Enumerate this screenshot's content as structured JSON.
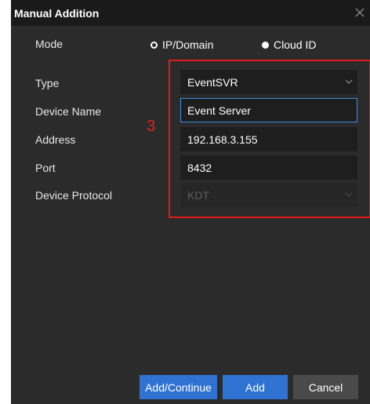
{
  "dialog": {
    "title": "Manual Addition"
  },
  "form": {
    "mode_label": "Mode",
    "mode_options": [
      "IP/Domain",
      "Cloud ID"
    ],
    "mode_selected": "IP/Domain",
    "type_label": "Type",
    "type_value": "EventSVR",
    "device_name_label": "Device Name",
    "device_name_value": "Event Server",
    "address_label": "Address",
    "address_value": "192.168.3.155",
    "port_label": "Port",
    "port_value": "8432",
    "protocol_label": "Device Protocol",
    "protocol_value": "KDT"
  },
  "annotation": {
    "step_number": "3",
    "color": "#e01b1b"
  },
  "footer": {
    "add_continue_label": "Add/Continue",
    "add_label": "Add",
    "cancel_label": "Cancel"
  },
  "icons": {
    "close": "close-icon",
    "type_dropdown": "chevron-down-icon",
    "protocol_dropdown": "chevron-down-icon"
  },
  "colors": {
    "accent": "#2f72d1",
    "focus_border": "#3a8ee6"
  }
}
